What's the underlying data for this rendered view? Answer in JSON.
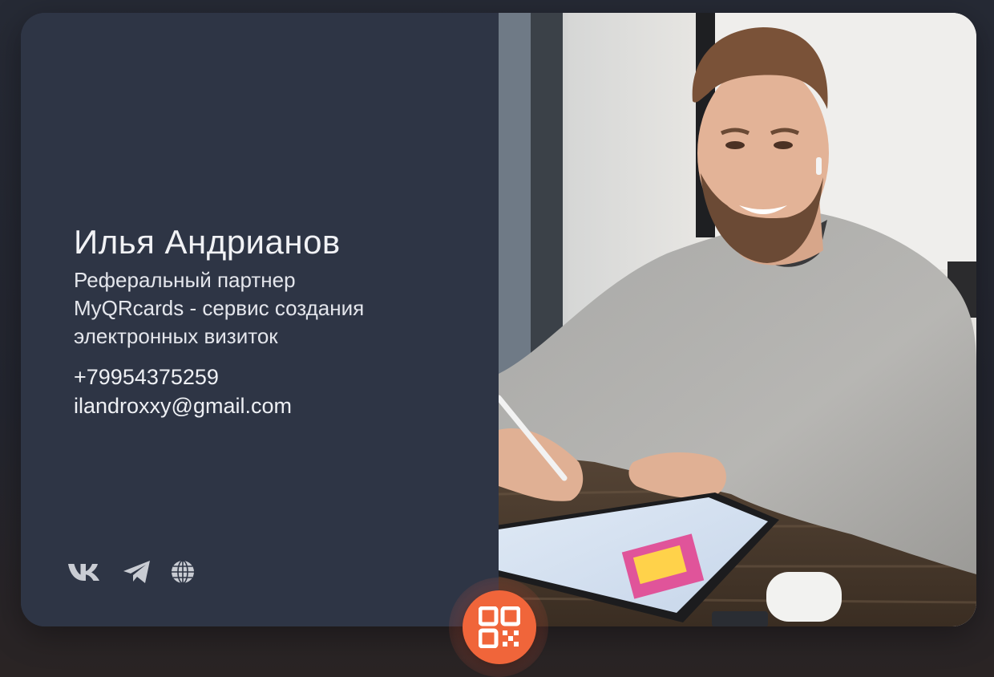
{
  "profile": {
    "name": "Илья Андрианов",
    "role_lines": [
      "Реферальный партнер",
      "MyQRcards - сервис создания",
      "электронных визиток"
    ],
    "phone": "+79954375259",
    "email": "ilandroxxy@gmail.com"
  },
  "socials": [
    {
      "name": "vk",
      "icon": "vk-icon"
    },
    {
      "name": "telegram",
      "icon": "telegram-icon"
    },
    {
      "name": "website",
      "icon": "globe-icon"
    }
  ],
  "qr_button": {
    "icon": "qr-code-icon"
  },
  "colors": {
    "card_background": "#2e3545",
    "accent": "#f0653a",
    "text": "#f1f2f5"
  }
}
